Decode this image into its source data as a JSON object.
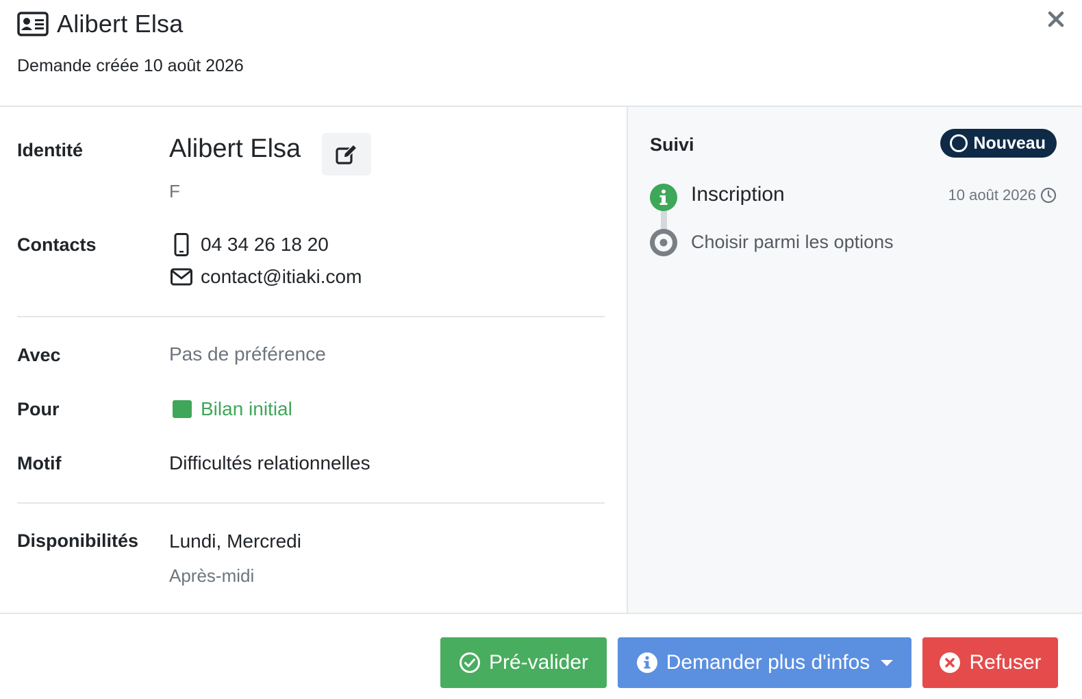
{
  "header": {
    "title": "Alibert Elsa",
    "subtitle": "Demande créée 10 août 2026",
    "title_icon": "id-card-icon",
    "close_icon": "close-icon"
  },
  "identity": {
    "label": "Identité",
    "name": "Alibert Elsa",
    "gender": "F",
    "edit_icon": "edit-icon"
  },
  "contacts": {
    "label": "Contacts",
    "phone": "04 34 26 18 20",
    "email": "contact@itiaki.com"
  },
  "avec": {
    "label": "Avec",
    "value": "Pas de préférence"
  },
  "pour": {
    "label": "Pour",
    "value": "Bilan initial",
    "color": "#3ea75a"
  },
  "motif": {
    "label": "Motif",
    "value": "Difficultés relationnelles"
  },
  "disponibilites": {
    "label": "Disponibilités",
    "days": "Lundi, Mercredi",
    "time": "Après-midi"
  },
  "suivi": {
    "title": "Suivi",
    "badge": "Nouveau",
    "badge_color": "#0e2a47",
    "events": [
      {
        "label": "Inscription",
        "date": "10 août 2026",
        "icon": "info-circle-icon"
      },
      {
        "label": "Choisir parmi les options",
        "icon": "dot-circle-icon"
      }
    ]
  },
  "footer": {
    "prevalidate_label": "Pré-valider",
    "more_info_label": "Demander plus d'infos",
    "refuse_label": "Refuser",
    "colors": {
      "green": "#48ad5f",
      "blue": "#5b8fe0",
      "red": "#e54b4b"
    }
  }
}
